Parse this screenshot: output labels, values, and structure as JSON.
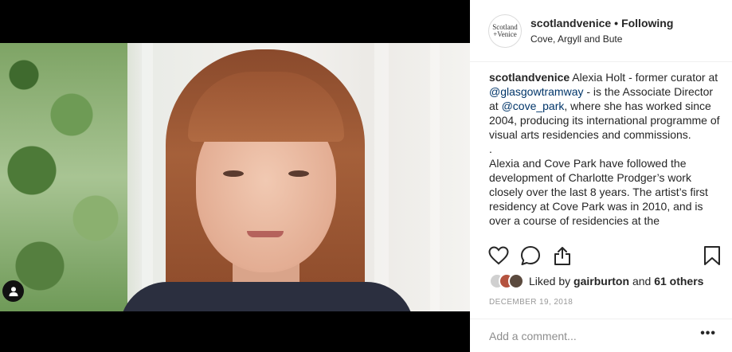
{
  "post": {
    "username": "scotlandvenice",
    "follow_status": "Following",
    "separator": "•",
    "location": "Cove, Argyll and Bute",
    "avatar_lines": [
      "Scotland",
      "+Venice"
    ],
    "caption": {
      "username": "scotlandvenice",
      "part1": "Alexia Holt - former curator at",
      "mention1": "@glasgowtramway",
      "part2": "- is the Associate Director at",
      "mention2": "@cove_park",
      "part3": ", where she has worked since 2004, producing its international programme of visual arts residencies and commissions.",
      "spacer": ".",
      "part4": "Alexia and Cove Park have followed the development of Charlotte Prodger’s work closely over the last 8 years. The artist’s first residency at Cove Park was in 2010, and is over a course of residencies at the"
    },
    "likes": {
      "prefix": "Liked by",
      "user": "gairburton",
      "conjunction": "and",
      "others": "61 others"
    },
    "date": "DECEMBER 19, 2018",
    "comment_placeholder": "Add a comment...",
    "more_label": "•••"
  },
  "icons": {
    "like": "heart-icon",
    "comment": "comment-icon",
    "share": "share-icon",
    "save": "bookmark-icon",
    "user_tag": "user-tag-icon"
  },
  "colors": {
    "link": "#003569",
    "text": "#262626",
    "muted": "#999999",
    "media_bg": "#000000"
  }
}
